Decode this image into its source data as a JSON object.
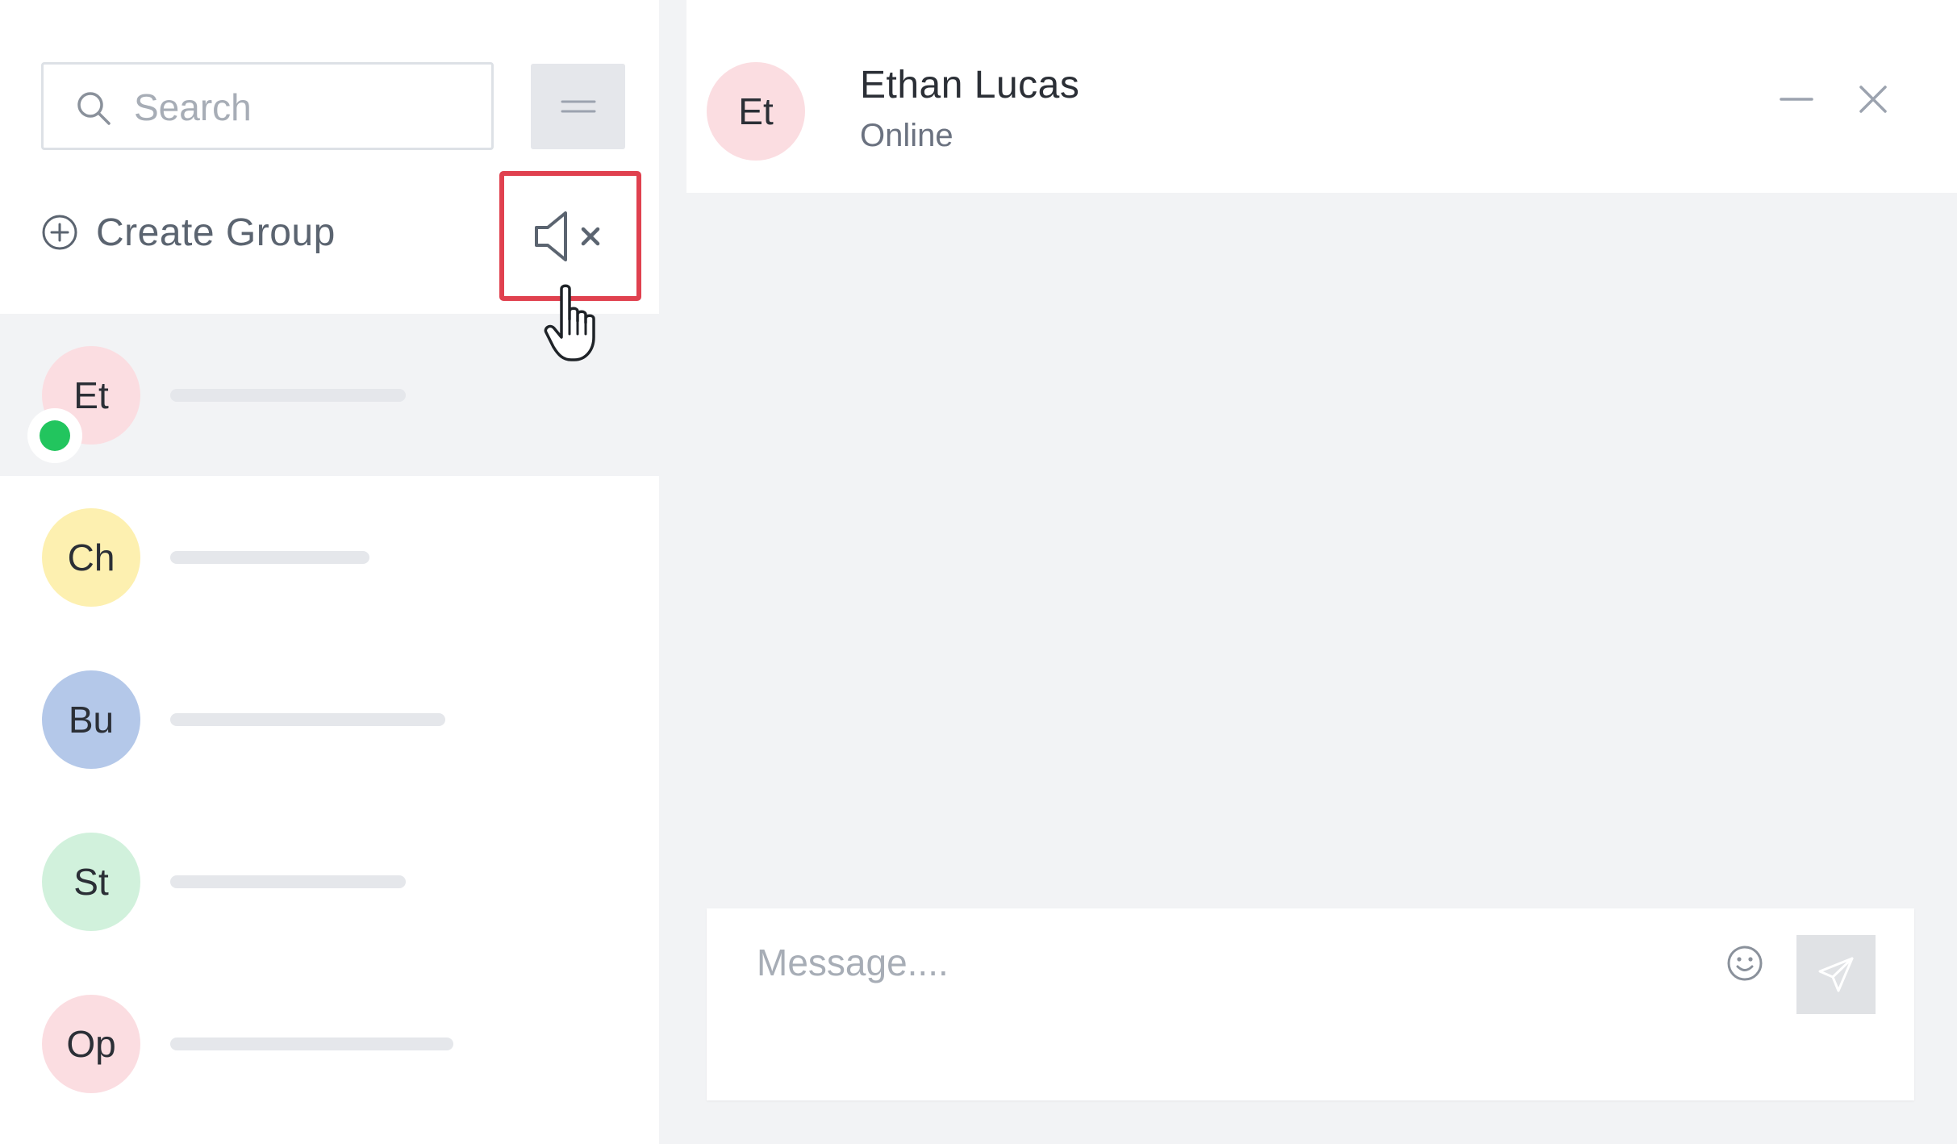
{
  "sidebar": {
    "search": {
      "placeholder": "Search",
      "value": "",
      "icon": "search-icon"
    },
    "menu_button": {
      "icon": "menu-icon"
    },
    "create_group": {
      "label": "Create Group",
      "icon": "plus-circle-icon"
    },
    "mute_button": {
      "icon": "speaker-muted-icon",
      "highlight_color": "#e0414f"
    },
    "contacts": [
      {
        "initials": "Et",
        "avatar_color": "#fbdde1",
        "online": true,
        "active": true
      },
      {
        "initials": "Ch",
        "avatar_color": "#fdf0b0",
        "online": false,
        "active": false
      },
      {
        "initials": "Bu",
        "avatar_color": "#b4c8e9",
        "online": false,
        "active": false
      },
      {
        "initials": "St",
        "avatar_color": "#d1f1dc",
        "online": false,
        "active": false
      },
      {
        "initials": "Op",
        "avatar_color": "#fbdde1",
        "online": false,
        "active": false
      }
    ]
  },
  "chat": {
    "header": {
      "initials": "Et",
      "avatar_color": "#fbdde1",
      "name": "Ethan Lucas",
      "status": "Online"
    },
    "composer": {
      "placeholder": "Message....",
      "value": "",
      "emoji_icon": "smiley-icon",
      "send_icon": "send-icon"
    }
  },
  "colors": {
    "online": "#22c55e",
    "panel_background": "#f2f3f5"
  }
}
